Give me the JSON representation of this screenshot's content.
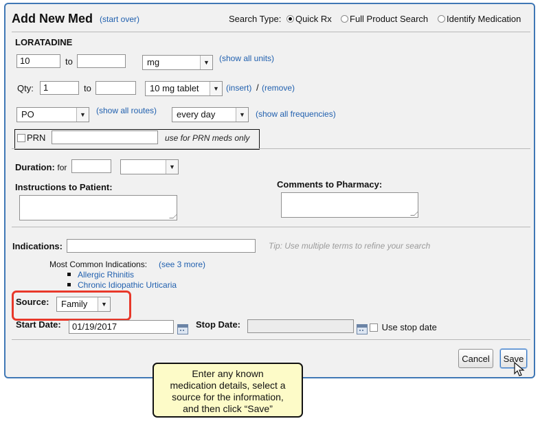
{
  "header": {
    "title": "Add New Med",
    "start_over": "(start over)",
    "search_type_label": "Search Type:",
    "search_options": [
      "Quick Rx",
      "Full Product Search",
      "Identify Medication"
    ],
    "search_selected": "Quick Rx"
  },
  "drug": {
    "name": "LORATADINE",
    "dose_from": "10",
    "dose_to_label": "to",
    "dose_to": "",
    "unit": "mg",
    "show_all_units": "(show all units)"
  },
  "qty": {
    "label": "Qty:",
    "from": "1",
    "to_label": "to",
    "to": "",
    "form": "10 mg tablet",
    "insert": "(insert)",
    "separator": "/",
    "remove": "(remove)"
  },
  "route": {
    "value": "PO",
    "show_all_routes": "(show all routes)",
    "frequency": "every day",
    "show_all_frequencies": "(show all frequencies)"
  },
  "prn": {
    "label": "PRN",
    "value": "",
    "hint": "use for PRN meds only"
  },
  "duration": {
    "label": "Duration:",
    "for_label": "for",
    "value": "",
    "unit": ""
  },
  "instructions": {
    "patient_label": "Instructions to Patient:",
    "pharmacy_label": "Comments to Pharmacy:"
  },
  "indications": {
    "label": "Indications:",
    "value": "",
    "tip": "Tip: Use multiple terms to refine your search",
    "common_label": "Most Common Indications:",
    "see_more": "(see 3 more)",
    "items": [
      "Allergic Rhinitis",
      "Chronic Idiopathic Urticaria"
    ]
  },
  "source": {
    "label": "Source:",
    "value": "Family"
  },
  "dates": {
    "start_label": "Start Date:",
    "start_value": "01/19/2017",
    "stop_label": "Stop Date:",
    "stop_value": "",
    "use_stop_date": "Use stop date"
  },
  "buttons": {
    "cancel": "Cancel",
    "save": "Save"
  },
  "callout": {
    "lines": [
      "Enter any known",
      "medication details, select a",
      "source for the information,",
      "and then click “Save”"
    ]
  },
  "colors": {
    "panel_border": "#3f77b5",
    "link": "#1f5fae",
    "highlight": "#e8382a",
    "callout_bg": "#fdfbc8"
  }
}
